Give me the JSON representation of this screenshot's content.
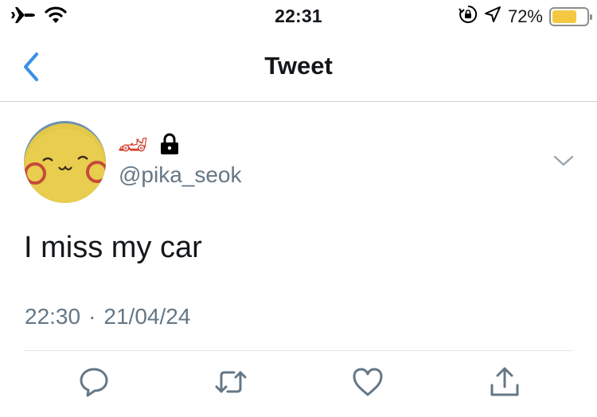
{
  "status_bar": {
    "time": "22:31",
    "battery_percent": "72%",
    "battery_level": 0.72,
    "battery_color": "#f5c842",
    "icons": [
      "airplane-icon",
      "wifi-icon",
      "orientation-lock-icon",
      "location-icon",
      "battery-icon"
    ]
  },
  "nav": {
    "title": "Tweet",
    "back_icon": "chevron-left-icon",
    "accent_color": "#3a8fe6"
  },
  "tweet": {
    "display_name_emoji": "🏎",
    "protected_icon": "lock-icon",
    "handle": "@pika_seok",
    "text": "I miss my car",
    "time": "22:30",
    "separator": "·",
    "date": "21/04/24",
    "menu_icon": "chevron-down-icon"
  },
  "actions": [
    {
      "name": "reply",
      "icon": "reply-icon"
    },
    {
      "name": "retweet",
      "icon": "retweet-icon"
    },
    {
      "name": "like",
      "icon": "heart-icon"
    },
    {
      "name": "share",
      "icon": "share-icon"
    }
  ],
  "colors": {
    "secondary_text": "#657786",
    "primary_text": "#14171a",
    "action_icon": "#657786"
  }
}
